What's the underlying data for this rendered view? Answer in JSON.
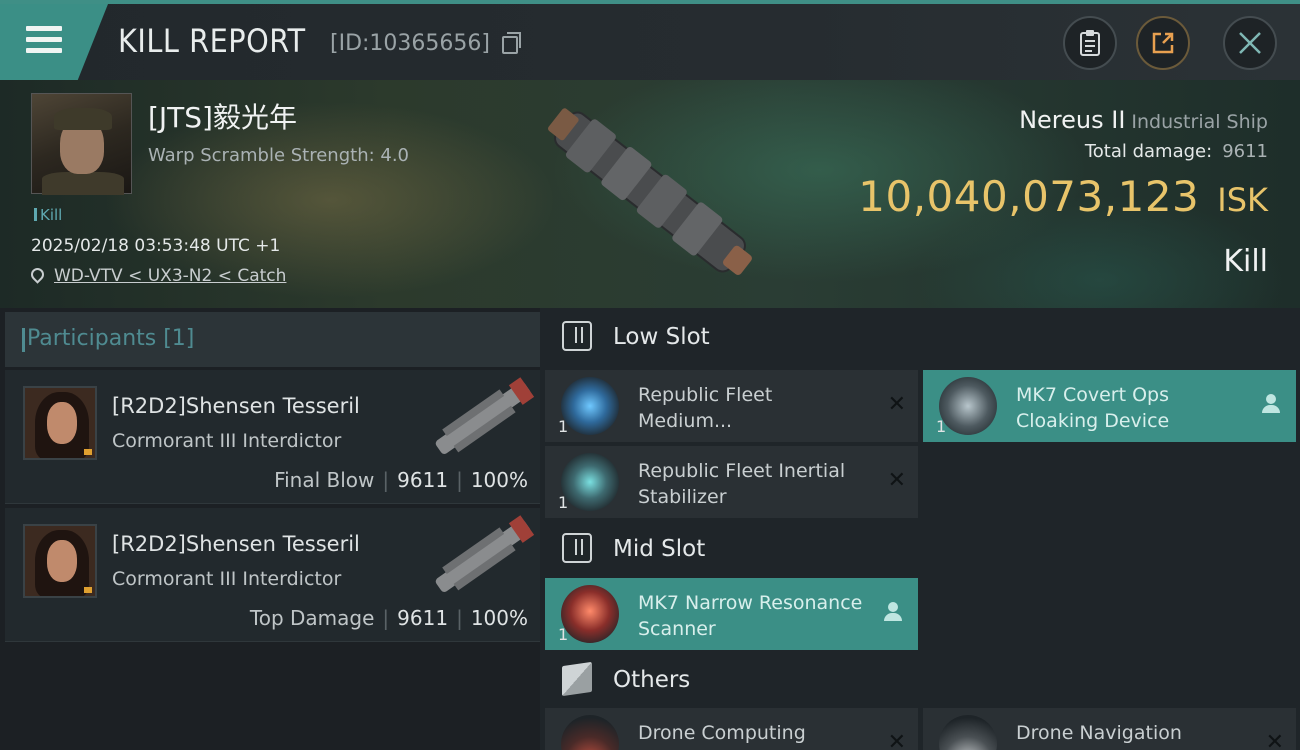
{
  "header": {
    "title": "KILL REPORT",
    "report_id": "[ID:10365656]"
  },
  "victim": {
    "pilot_name": "[JTS]毅光年",
    "warp_scramble": "Warp Scramble Strength: 4.0",
    "kill_tag": "Kill",
    "datetime": "2025/02/18 03:53:48 UTC +1",
    "location": "WD-VTV < UX3-N2 < Catch",
    "ship_name": "Nereus II",
    "ship_class": "Industrial Ship",
    "total_damage_label": "Total damage:",
    "total_damage_value": "9611",
    "isk_value": "10,040,073,123",
    "isk_unit": "ISK",
    "result": "Kill"
  },
  "participants": {
    "label": "Participants [1]",
    "cards": [
      {
        "name": "[R2D2]Shensen Tesseril",
        "ship": "Cormorant III Interdictor",
        "tag": "Final Blow",
        "damage": "9611",
        "percent": "100%"
      },
      {
        "name": "[R2D2]Shensen Tesseril",
        "ship": "Cormorant III Interdictor",
        "tag": "Top Damage",
        "damage": "9611",
        "percent": "100%"
      }
    ]
  },
  "slots": {
    "low": {
      "label": "Low Slot",
      "modules": [
        {
          "name": "Republic Fleet Medium...",
          "qty": "1",
          "state": "destroyed"
        },
        {
          "name": "MK7 Covert Ops Cloaking Device",
          "qty": "1",
          "state": "dropped"
        },
        {
          "name": "Republic Fleet Inertial Stabilizer",
          "qty": "1",
          "state": "destroyed"
        }
      ]
    },
    "mid": {
      "label": "Mid Slot",
      "modules": [
        {
          "name": "MK7 Narrow Resonance Scanner",
          "qty": "1",
          "state": "dropped"
        }
      ]
    },
    "others": {
      "label": "Others",
      "modules": [
        {
          "name": "Drone Computing",
          "qty": "",
          "state": "destroyed"
        },
        {
          "name": "Drone Navigation",
          "qty": "",
          "state": "destroyed"
        }
      ]
    }
  },
  "icons": {
    "menu": "hamburger-menu-icon",
    "copy": "copy-icon",
    "report": "clipboard-icon",
    "share": "share-icon",
    "close": "close-icon",
    "location": "map-pin-icon",
    "destroyed": "x-icon",
    "dropped": "person-icon"
  },
  "colors": {
    "accent": "#3b8f86",
    "isk": "#e8c46a",
    "participants_label": "#4f8b91"
  }
}
